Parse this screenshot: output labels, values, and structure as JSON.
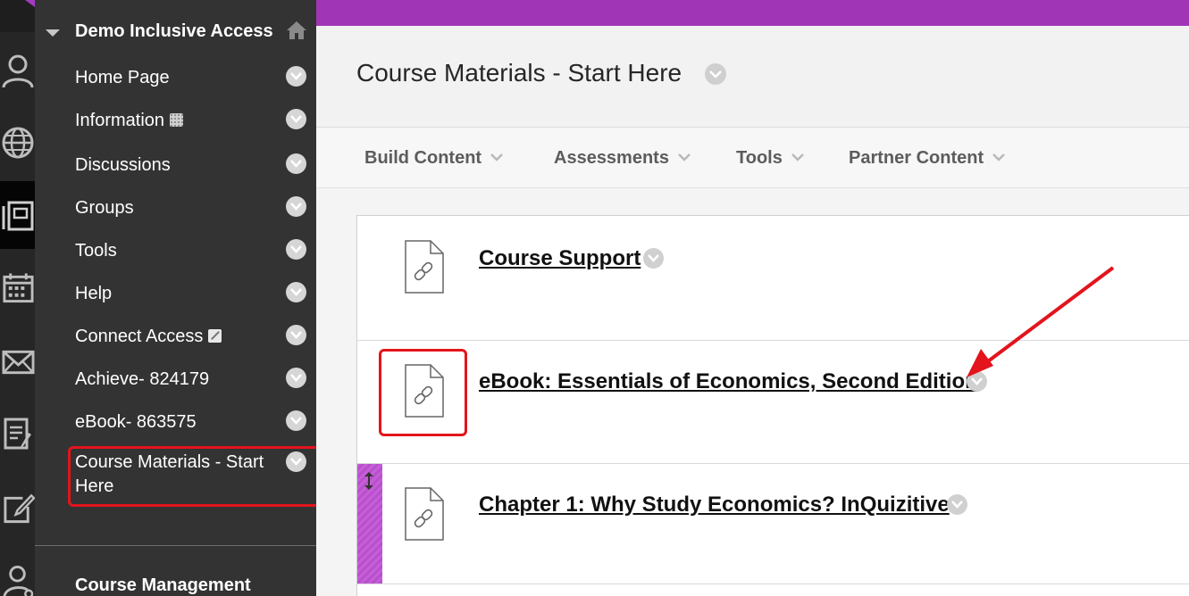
{
  "colors": {
    "accent": "#a036b6",
    "menu_bg": "#333333",
    "highlight": "#e3141c"
  },
  "rail": {
    "icons": [
      "user-icon",
      "globe-icon",
      "courses-icon",
      "calendar-icon",
      "mail-icon",
      "grades-icon",
      "edit-icon",
      "user-settings-icon"
    ]
  },
  "course_menu": {
    "title": "Demo Inclusive Access",
    "items": [
      {
        "label": "Home Page"
      },
      {
        "label": "Information"
      },
      {
        "label": "Discussions"
      },
      {
        "label": "Groups"
      },
      {
        "label": "Tools"
      },
      {
        "label": "Help"
      },
      {
        "label": "Connect Access"
      },
      {
        "label": "Achieve- 824179"
      },
      {
        "label": "eBook- 863575"
      },
      {
        "label": "Course Materials - Start Here"
      }
    ],
    "management_title": "Course Management"
  },
  "page": {
    "title": "Course Materials - Start Here"
  },
  "action_bar": {
    "buttons": [
      "Build Content",
      "Assessments",
      "Tools",
      "Partner Content"
    ]
  },
  "content_items": [
    {
      "title": "Course Support",
      "icon": "link-file-icon"
    },
    {
      "title": "eBook: Essentials of Economics, Second Edition",
      "icon": "link-file-icon"
    },
    {
      "title": "Chapter 1: Why Study Economics? InQuizitive",
      "icon": "link-file-icon"
    }
  ]
}
